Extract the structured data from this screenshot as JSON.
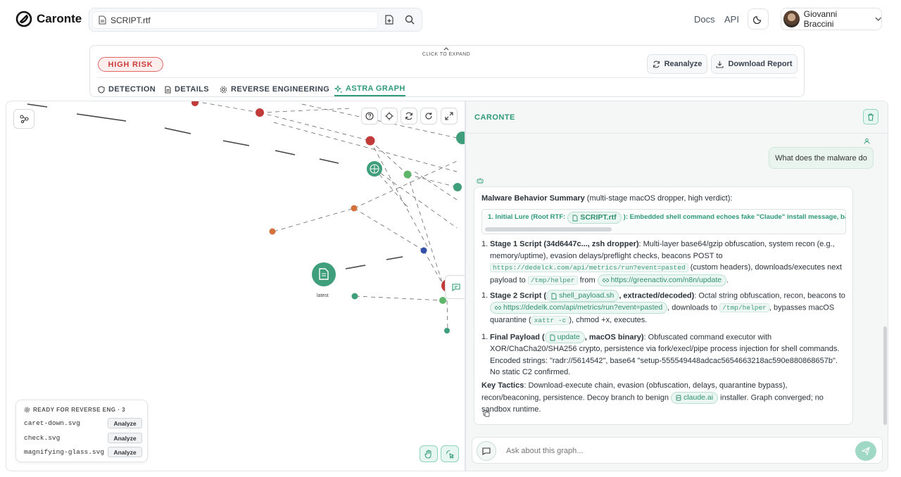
{
  "app": {
    "name": "Caronte"
  },
  "file": {
    "name": "SCRIPT.rtf"
  },
  "nav": {
    "docs": "Docs",
    "api": "API"
  },
  "user": {
    "name": "Giovanni Braccini"
  },
  "analysis": {
    "risk_label": "HIGH RISK",
    "expand_label": "CLICK TO EXPAND",
    "reanalyze": "Reanalyze",
    "download": "Download Report",
    "tabs": [
      {
        "label": "DETECTION"
      },
      {
        "label": "DETAILS"
      },
      {
        "label": "REVERSE ENGINEERING"
      },
      {
        "label": "ASTRA GRAPH"
      }
    ]
  },
  "graph": {
    "node_label": "latest",
    "reverse": {
      "title": "READY FOR REVERSE ENG · 3",
      "analyze": "Analyze",
      "items": [
        "caret-down.svg",
        "check.svg",
        "magnifying-glass.svg"
      ]
    }
  },
  "chat": {
    "title": "CARONTE",
    "user_message": "What does the malware do",
    "input_placeholder": "Ask about this graph...",
    "answer": {
      "intro_bold": "Malware Behavior Summary",
      "intro_rest": " (multi-stage macOS dropper, high verdict):",
      "lure_prefix": "1. Initial Lure (Root RTF:",
      "lure_file": "SCRIPT.rtf",
      "lure_rest": "): Embedded shell command echoes fake \"Claude\" install message, base",
      "s1_num": "1.",
      "s1_title": "Stage 1 Script (34d6447c..., zsh dropper)",
      "s1_a": ": Multi-layer base64/gzip obfuscation, system recon (e.g., memory/uptime), evasion delays/preflight checks, beacons POST to",
      "s1_url": "https://dedelck.com/api/metrics/run?event=pasted",
      "s1_b": "(custom headers), downloads/executes next payload to",
      "s1_path": "/tmp/helper",
      "s1_c": "from",
      "s1_link": "https://greenactiv.com/n8n/update",
      "s1_end": ".",
      "s2_num": "1.",
      "s2_title_a": "Stage 2 Script (",
      "s2_file": "shell_payload.sh",
      "s2_title_b": ", extracted/decoded)",
      "s2_a": ": Octal string obfuscation, recon, beacons to",
      "s2_link": "https://dedelk.com/api/metrics/run?event=pasted",
      "s2_b": ", downloads to",
      "s2_path": "/tmp/helper",
      "s2_c": ", bypasses macOS quarantine (",
      "s2_cmd": "xattr -c",
      "s2_d": "), chmod +x, executes.",
      "s3_num": "1.",
      "s3_title_a": "Final Payload (",
      "s3_file": "update",
      "s3_title_b": ", macOS binary)",
      "s3_a": ": Obfuscated command executor with XOR/ChaCha20/SHA256 crypto, persistence via fork/execl/pipe process injection for shell commands. Encoded strings: \"radr://5614542\", base64 \"setup-555549448adcac5654663218ac590e880868657b\". No static C2 confirmed.",
      "tactics_bold": "Key Tactics",
      "tactics_a": ": Download-execute chain, evasion (obfuscation, delays, quarantine bypass), recon/beaconing, persistence. Decoy branch to benign",
      "tactics_link": "claude.ai",
      "tactics_b": "installer. Graph converged; no sandbox runtime."
    }
  },
  "colors": {
    "accent": "#2e9a78",
    "risk": "#cc3b3b"
  }
}
